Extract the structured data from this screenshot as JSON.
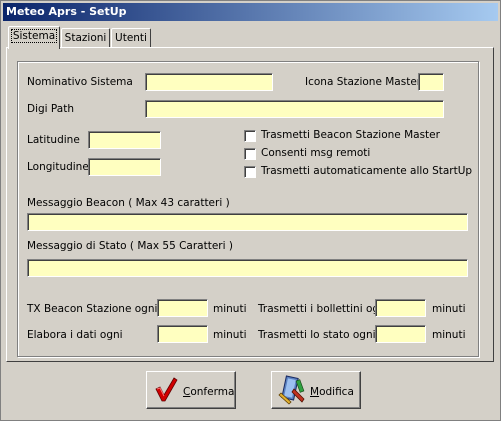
{
  "window": {
    "title": "Meteo Aprs - SetUp"
  },
  "tabs": [
    {
      "label": "Sistema",
      "active": true
    },
    {
      "label": "Stazioni",
      "active": false
    },
    {
      "label": "Utenti",
      "active": false
    }
  ],
  "form": {
    "nominativo_label": "Nominativo Sistema",
    "nominativo_value": "",
    "icona_label": "Icona Stazione Master",
    "icona_value": "",
    "digi_label": "Digi Path",
    "digi_value": "",
    "latitudine_label": "Latitudine",
    "latitudine_value": "",
    "longitudine_label": "Longitudine",
    "longitudine_value": "",
    "checkboxes": [
      {
        "label": "Trasmetti Beacon Stazione Master",
        "checked": false
      },
      {
        "label": "Consenti msg remoti",
        "checked": false
      },
      {
        "label": "Trasmetti automaticamente allo StartUp",
        "checked": false
      }
    ],
    "beacon_msg_label": "Messaggio Beacon ( Max 43 caratteri )",
    "beacon_msg_value": "",
    "stato_msg_label": "Messaggio di Stato ( Max 55 Caratteri )",
    "stato_msg_value": "",
    "tx_beacon_label": "TX Beacon Stazione ogni",
    "tx_beacon_value": "",
    "elabora_label": "Elabora i dati ogni",
    "elabora_value": "",
    "bollettini_label": "Trasmetti i bollettini ogni",
    "bollettini_value": "",
    "stato_ogni_label": "Trasmetti lo stato ogni",
    "stato_ogni_value": "",
    "unit": "minuti"
  },
  "buttons": {
    "conferma": {
      "first": "C",
      "rest": "onferma",
      "icon": "checkmark-icon"
    },
    "modifica": {
      "first": "M",
      "rest": "odifica",
      "icon": "edit-tool-icon"
    }
  },
  "colors": {
    "field_bg": "#ffffc0",
    "title_start": "#0a246a",
    "title_end": "#a6caf0"
  }
}
